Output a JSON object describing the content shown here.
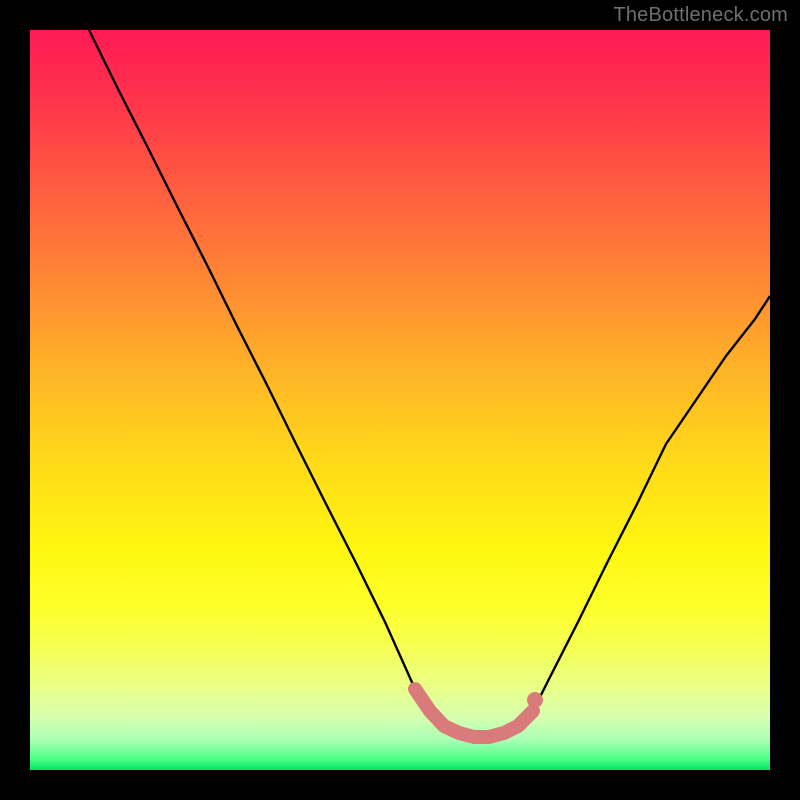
{
  "watermark": "TheBottleneck.com",
  "chart_data": {
    "type": "line",
    "title": "",
    "xlabel": "",
    "ylabel": "",
    "xlim": [
      0,
      100
    ],
    "ylim": [
      0,
      100
    ],
    "note": "Background heat gradient from red (top, high bottleneck) to green (bottom, low bottleneck). Black curve traces bottleneck percentage over the x-range, dipping to a minimum plateau ~x=52–68.",
    "series": [
      {
        "name": "bottleneck-curve",
        "x": [
          8,
          12,
          16,
          20,
          24,
          28,
          32,
          36,
          40,
          44,
          48,
          52,
          54,
          56,
          58,
          60,
          62,
          64,
          66,
          68,
          70,
          74,
          78,
          82,
          86,
          90,
          94,
          98,
          100
        ],
        "y": [
          100,
          92,
          84,
          76,
          68,
          60,
          52,
          44,
          36,
          28,
          20,
          11,
          8,
          6,
          5,
          4.5,
          4.5,
          5,
          6,
          8,
          12,
          20,
          28,
          36,
          44,
          50,
          56,
          61,
          64
        ]
      },
      {
        "name": "valley-marker",
        "x": [
          52,
          54,
          56,
          58,
          60,
          62,
          64,
          66,
          68
        ],
        "y": [
          11,
          8,
          6,
          5,
          4.5,
          4.5,
          5,
          6,
          8
        ]
      }
    ],
    "colors": {
      "curve": "#000000",
      "marker": "#d97b7b",
      "marker_end_dot": "#d97b7b"
    }
  }
}
